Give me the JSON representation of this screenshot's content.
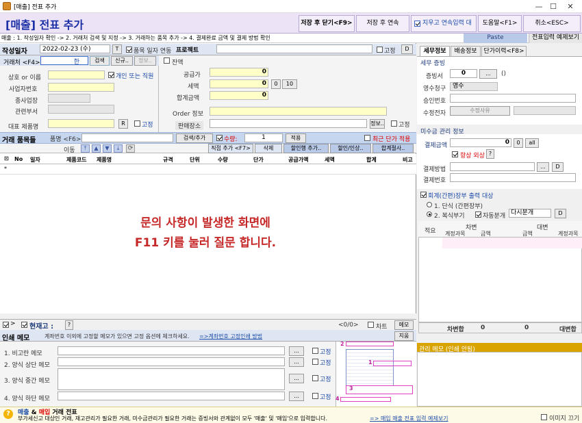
{
  "window": {
    "title": "[매출] 전표 추가",
    "min": "—",
    "max": "☐",
    "close": "✕"
  },
  "header": {
    "title": "[매출] 전표 추가",
    "save_close": "저장 후 닫기<F9>",
    "save_continue": "저장 후 연속<F10>",
    "clear_check": "지우고 연속입력 대기",
    "help": "도움말<F1>",
    "cancel": "취소<ESC>"
  },
  "subbar": {
    "steps": "매출 : 1. 작성일자 확인 -> 2. 거래처 검색 및 지정 -> 3. 거래하는 품목 추가 -> 4. 결제완료 금액 및 결제 방법 확인",
    "paste": "Paste",
    "example": "전표입력 예제보기"
  },
  "top": {
    "date_label": "작성일자",
    "date_value": "2022-02-23 (수)",
    "t_btn": "T",
    "item_date_link": "품목 일자 연동",
    "project_label": "프로젝트",
    "fixed": "고정",
    "d_btn": "D"
  },
  "customer": {
    "label": "거래처 <F4>",
    "value": "한",
    "search": "검색",
    "new": "신규..",
    "info": "정보..",
    "name_label": "상호 or 이름",
    "personal": "개인 또는 직원",
    "biz_no": "사업자번호",
    "workplace": "종사업장",
    "dept": "관련부서",
    "rep_item": "대표 제품명",
    "r_btn": "R",
    "fixed": "고정"
  },
  "amounts": {
    "balance": "잔액",
    "supply_label": "공급가",
    "supply": "0",
    "tax_label": "세액",
    "tax": "0",
    "zero": "0",
    "ten": "10",
    "total_label": "합계금액",
    "total": "0",
    "order_label": "Order 정보",
    "seller_label": "판매장소",
    "fixed": "고정"
  },
  "items": {
    "section": "거래 품목들",
    "item_label": "품명 <F6>",
    "search_add": "검색/추가",
    "qty_label": "수량:",
    "qty": "1",
    "apply": "적용",
    "recent_price": "최근 단가 적용",
    "move": "이동",
    "direct_add": "직접 추가 <F7>",
    "delete": "삭제",
    "discount_add": "할인행 추가..",
    "discount_markup": "할인/인상..",
    "total_split": "합계절사..",
    "columns": [
      "No",
      "일자",
      "제품코드",
      "제품명",
      "규격",
      "단위",
      "수량",
      "단가",
      "공급가액",
      "세액",
      "합계",
      "비고"
    ],
    "row_marker": "*"
  },
  "overlay": {
    "line1": "문의 사항이 발생한 화면에",
    "line2": "F11 키를 눌러 질문 합니다."
  },
  "bottom": {
    "current_stock": "현재고 :",
    "q": "?",
    "count": "<0/0>",
    "chart": "차트",
    "memo_btn": "메모",
    "delete_btn": "지움",
    "print_memo": "인쇄 메모",
    "print_hint": "계좌번호 이외에 고정할 메모가 있으면 고정 옵션에 체크하세요.",
    "print_link": "=>계좌번호 고정인쇄 방법",
    "memo1": "1. 비고란 메모",
    "memo2": "2. 양식 상단 메모",
    "memo3": "3. 양식 중간 메모",
    "memo4": "4. 양식 하단 메모",
    "dots": "...",
    "fixed": "고정",
    "thumb_nums": [
      "2",
      "1",
      "3",
      "4"
    ]
  },
  "right": {
    "tabs": [
      "세무정보",
      "배송정보",
      "단가이력<F8>"
    ],
    "tax_sec": "세무 증빙",
    "proof_label": "증빙서",
    "proof_value": "0",
    "proof_btn": "...",
    "proof_paren": "()",
    "claim_label": "영수청구",
    "claim_value": "영수",
    "approve_label": "승인번호",
    "edit_label": "수정전자",
    "edit_btn": "수정사유",
    "receivable_sec": "미수금 관리 정보",
    "pay_amount_label": "결제금액",
    "pay_amount": "0",
    "zero_btn": "0",
    "all_btn": "all",
    "credit": "항상 외상",
    "q": "?",
    "pay_method_label": "결제방법",
    "pay_no_label": "결제번호",
    "dots": "...",
    "d_btn": "D",
    "ledger_sec": "회계(간편)장부 출력 대상",
    "opt1": "1. 단식 (간편장부)",
    "opt2": "2. 복식부기",
    "auto_split": "자동분개",
    "split_sel": "다시분개",
    "ledger_cols": {
      "summary": "적요",
      "debit": "차변",
      "credit": "대변",
      "acct": "계정과목",
      "amount": "금액"
    },
    "debit_total_label": "차변합",
    "debit_total": "0",
    "credit_total": "0",
    "credit_total_label": "대변합",
    "mgmt_memo": "관리 메모 (인쇄 안됨)"
  },
  "footer": {
    "title1": "매출",
    "amp": " & ",
    "title2": "매입",
    "title3": " 거래 전표",
    "desc": "부가세신고 대상인 거래, 재고관리가 필요한 거래, 미수금관리가 필요한 거래는 증빙서와 관계없이 모두 '매출' 및 '매입'으로 입력합니다.",
    "link": "=> 매입 매출 전표 입력 예제보기",
    "hide_img": "이미지 끄기"
  }
}
